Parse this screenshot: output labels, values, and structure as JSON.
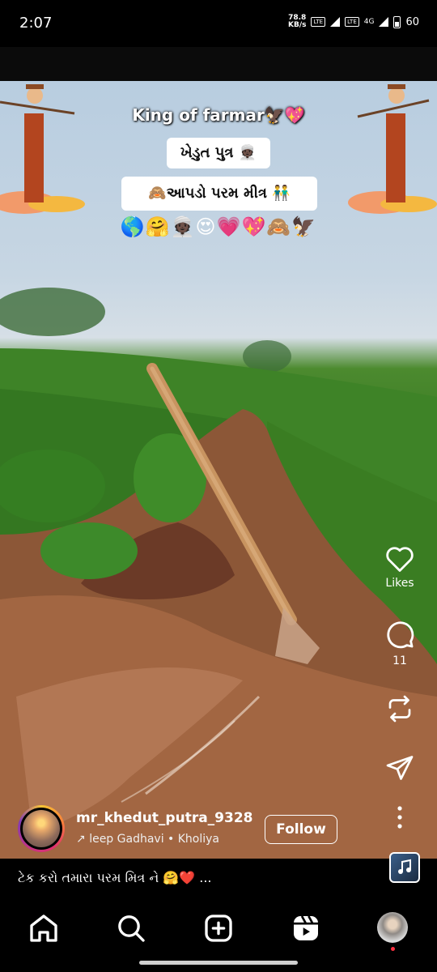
{
  "status": {
    "time": "2:07",
    "speed": "78.8",
    "speed_unit": "KB/s",
    "volte": "Vo LTE",
    "network": "4G",
    "battery": "60"
  },
  "video": {
    "title": "King of farmar🦅💖",
    "pill1": "ખેડુત પુત્ર 👳🏿",
    "pill2": "🙈આપડો પરમ મીત્ર 👬",
    "emoji_row": "🌎🤗👳🏿😍💗💖🙈🦅"
  },
  "actions": {
    "likes_label": "Likes",
    "comments_count": "11"
  },
  "author": {
    "username": "mr_khedut_putra_9328",
    "audio": "leep Gadhavi • Kholiya",
    "follow_label": "Follow"
  },
  "caption": {
    "text": "ટેક કરો તમારા પરમ મિત્ર ને 🤗❤️ ..."
  },
  "nav": {
    "items": [
      "home",
      "search",
      "create",
      "reels",
      "profile"
    ]
  }
}
